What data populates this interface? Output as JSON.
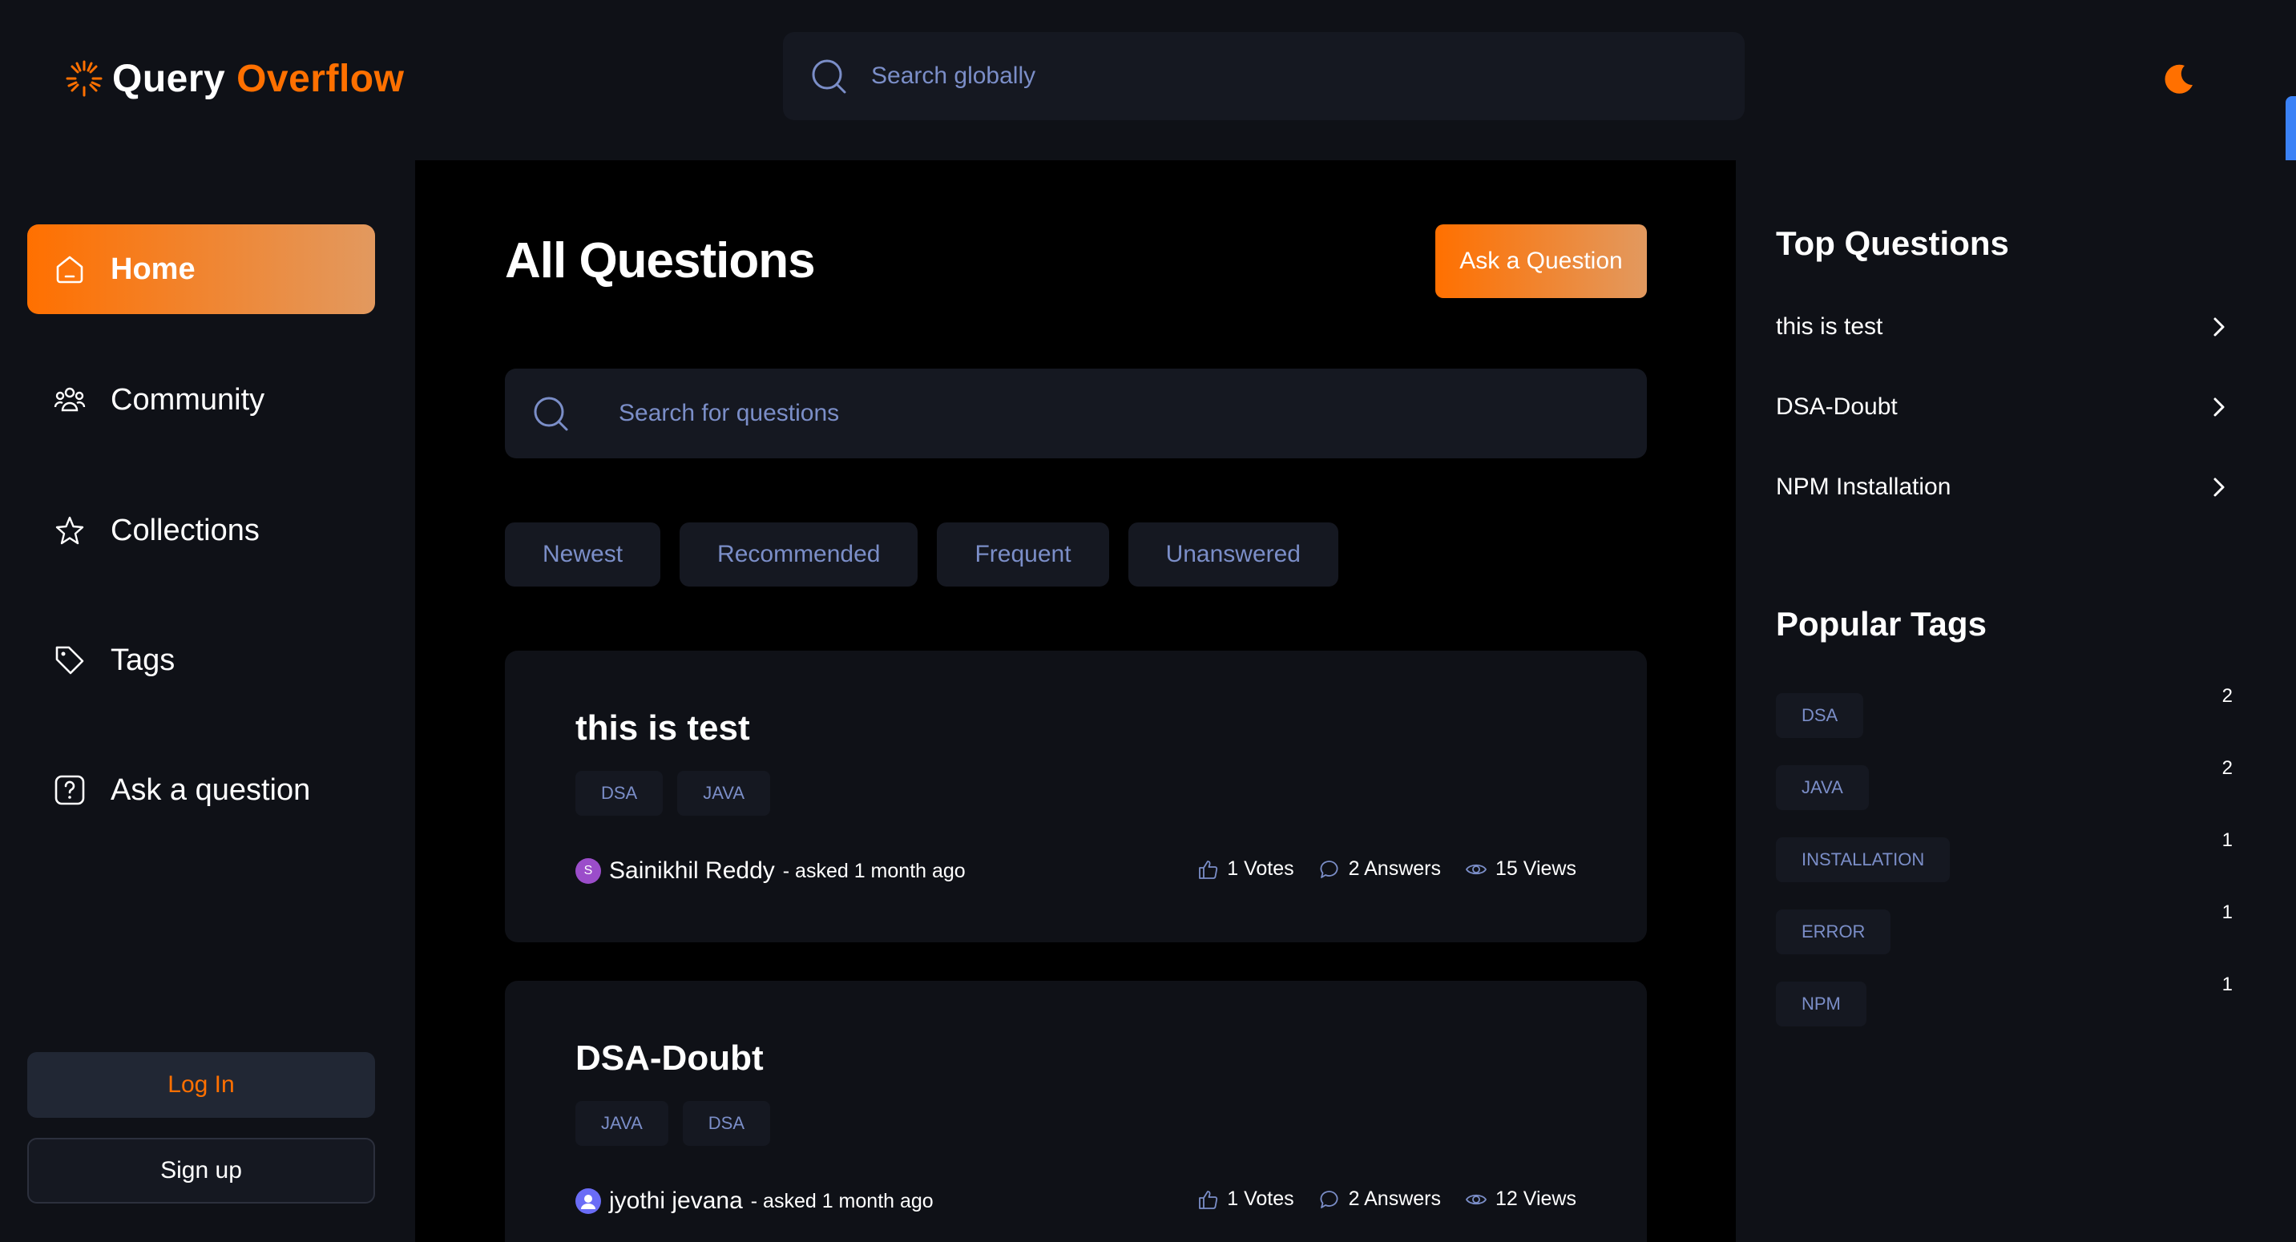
{
  "header": {
    "logo_word1": "Query",
    "logo_word2": "Overflow",
    "search_placeholder": "Search globally",
    "theme_icon": "moon-icon"
  },
  "colors": {
    "accent": "#ff7000",
    "accent_light": "#e2995f",
    "background": "#0f1117",
    "main_background": "#000000",
    "surface": "#151821",
    "muted_text": "#7b8ec8"
  },
  "sidebar": {
    "items": [
      {
        "label": "Home",
        "icon": "home-icon",
        "active": true
      },
      {
        "label": "Community",
        "icon": "users-icon",
        "active": false
      },
      {
        "label": "Collections",
        "icon": "star-icon",
        "active": false
      },
      {
        "label": "Tags",
        "icon": "tag-icon",
        "active": false
      },
      {
        "label": "Ask a question",
        "icon": "question-icon",
        "active": false
      }
    ],
    "login_label": "Log In",
    "signup_label": "Sign up"
  },
  "main": {
    "title": "All Questions",
    "ask_button": "Ask a Question",
    "search_placeholder": "Search for questions",
    "filters": [
      "Newest",
      "Recommended",
      "Frequent",
      "Unanswered"
    ],
    "questions": [
      {
        "title": "this is test",
        "tags": [
          "DSA",
          "JAVA"
        ],
        "author": "Sainikhil Reddy",
        "avatar_letter": "S",
        "asked": "- asked 1 month ago",
        "votes": "1 Votes",
        "answers": "2 Answers",
        "views": "15 Views"
      },
      {
        "title": "DSA-Doubt",
        "tags": [
          "JAVA",
          "DSA"
        ],
        "author": "jyothi jevana",
        "avatar_letter": "",
        "asked": "- asked 1 month ago",
        "votes": "1 Votes",
        "answers": "2 Answers",
        "views": "12 Views"
      }
    ]
  },
  "right_sidebar": {
    "top_questions_heading": "Top Questions",
    "top_questions": [
      "this is test",
      "DSA-Doubt",
      "NPM Installation"
    ],
    "popular_tags_heading": "Popular Tags",
    "popular_tags": [
      {
        "name": "DSA",
        "count": "2"
      },
      {
        "name": "JAVA",
        "count": "2"
      },
      {
        "name": "INSTALLATION",
        "count": "1"
      },
      {
        "name": "ERROR",
        "count": "1"
      },
      {
        "name": "NPM",
        "count": "1"
      }
    ]
  }
}
